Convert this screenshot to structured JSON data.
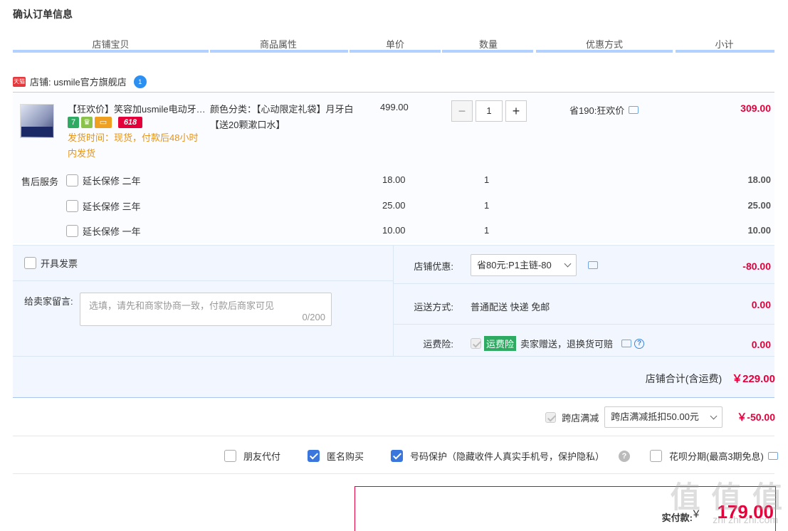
{
  "page_title": "确认订单信息",
  "columns": [
    "店铺宝贝",
    "商品属性",
    "单价",
    "数量",
    "优惠方式",
    "小计"
  ],
  "shop": {
    "badge": "天猫",
    "name": "店铺: usmile官方旗舰店",
    "ww_badge": "1"
  },
  "item": {
    "title": "【狂欢价】笑容加usmile电动牙刷...",
    "promo_icons": [
      {
        "text": "7",
        "color": "#2eaa62"
      },
      {
        "text": "♛",
        "color": "#8bc34a"
      },
      {
        "text": "▭",
        "color": "#f0a020"
      },
      {
        "text": "618",
        "color": "#e4003a"
      }
    ],
    "ship_note": "发货时间：现货，付款后48小时内发货",
    "attr": "颜色分类：【心动限定礼袋】月牙白【送20颗漱口水】",
    "price": "499.00",
    "qty": "1",
    "qty_minus": "−",
    "qty_plus": "+",
    "discount": "省190:狂欢价",
    "subtotal": "309.00"
  },
  "services": {
    "label": "售后服务",
    "rows": [
      {
        "name": "延长保修 二年",
        "price": "18.00",
        "qty": "1",
        "subtotal": "18.00"
      },
      {
        "name": "延长保修 三年",
        "price": "25.00",
        "qty": "1",
        "subtotal": "25.00"
      },
      {
        "name": "延长保修 一年",
        "price": "10.00",
        "qty": "1",
        "subtotal": "10.00"
      }
    ]
  },
  "invoice_label": "开具发票",
  "note": {
    "label": "给卖家留言:",
    "placeholder": "选填，请先和商家协商一致，付款后商家可见",
    "count": "0/200"
  },
  "shop_coupon": {
    "label": "店铺优惠:",
    "selected": "省80元:P1主链-80",
    "value": "-80.00"
  },
  "shipping": {
    "label": "运送方式:",
    "text": "普通配送 快递 免邮",
    "value": "0.00"
  },
  "insurance": {
    "label": "运费险:",
    "tag": "运费险",
    "text": "卖家赠送，退换货可赔",
    "help": "?",
    "value": "0.00"
  },
  "shop_total": {
    "label": "店铺合计(含运费)",
    "value": "￥229.00"
  },
  "cross_store": {
    "label": "跨店满减",
    "selected": "跨店满减抵扣50.00元",
    "value": "￥-50.00"
  },
  "options": {
    "friend_pay": "朋友代付",
    "anonymous": "匿名购买",
    "number_protect": "号码保护（隐藏收件人真实手机号，保护隐私）",
    "help": "?",
    "huabei": "花呗分期(最高3期免息)"
  },
  "payment": {
    "label": "实付款:",
    "currency": "￥",
    "value": "179.00"
  },
  "watermark": {
    "text": "值 值 值",
    "url": "zhi zhi zhi.com"
  },
  "colors": {
    "accent_red": "#e4003a",
    "header_line": "#b2d1ff",
    "panel_bg": "#f2f7ff",
    "link_blue": "#3a76dc"
  }
}
